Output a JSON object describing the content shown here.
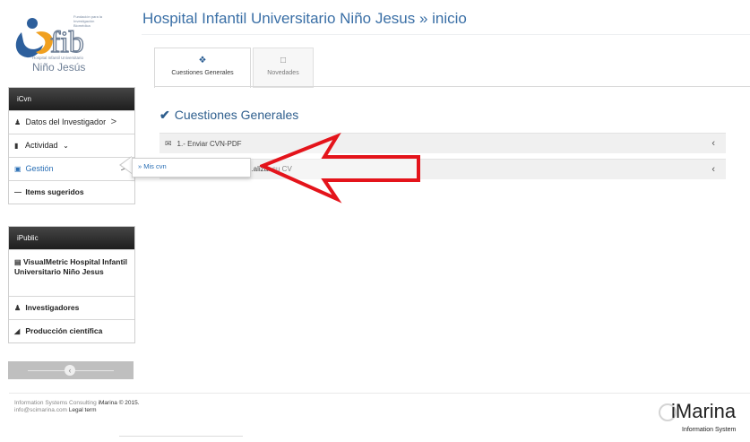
{
  "logo": {
    "fund_text": "Fundación para la Investigación Biomédica",
    "hospital_small": "Hospital Infantil Universitario",
    "nino": "Niño Jesús"
  },
  "title": "Hospital Infantil Universitario Niño Jesus » inicio",
  "sidebar": {
    "icvn": {
      "header": "iCvn",
      "items": [
        {
          "label": "Datos del Investigador",
          "chevron": ">"
        },
        {
          "label": "Actividad",
          "chevron": "⌄"
        },
        {
          "label": "Gestión",
          "chevron": ">"
        },
        {
          "label": "Items sugeridos"
        }
      ]
    },
    "ipublic": {
      "header": "iPublic",
      "items": [
        {
          "label": "VisualMetric Hospital Infantil Universitario Niño Jesus"
        },
        {
          "label": "Investigadores"
        },
        {
          "label": "Producción científica"
        }
      ]
    }
  },
  "tabs": [
    {
      "label": "Cuestiones Generales",
      "icon": "info-circle-icon",
      "active": true
    },
    {
      "label": "Novedades",
      "icon": "document-icon",
      "active": false
    }
  ],
  "section": {
    "heading": "Cuestiones Generales",
    "rows": [
      {
        "label": "1.- Enviar CVN-PDF"
      },
      {
        "label": "...alizar su CV"
      }
    ]
  },
  "popup": {
    "item": "» Mis cvn"
  },
  "footer": {
    "line1_prefix": "Information Systems Consulting",
    "line1_brand": "iMarina © 2015.",
    "line2_email": "info@scimarina.com",
    "line2_link": "Legal term",
    "brand": "iMarina",
    "brand_sub": "Information System"
  },
  "colors": {
    "accent_blue": "#2a6fb5",
    "arrow_red": "#e4141b",
    "panel_header": "#2a2a2a"
  }
}
